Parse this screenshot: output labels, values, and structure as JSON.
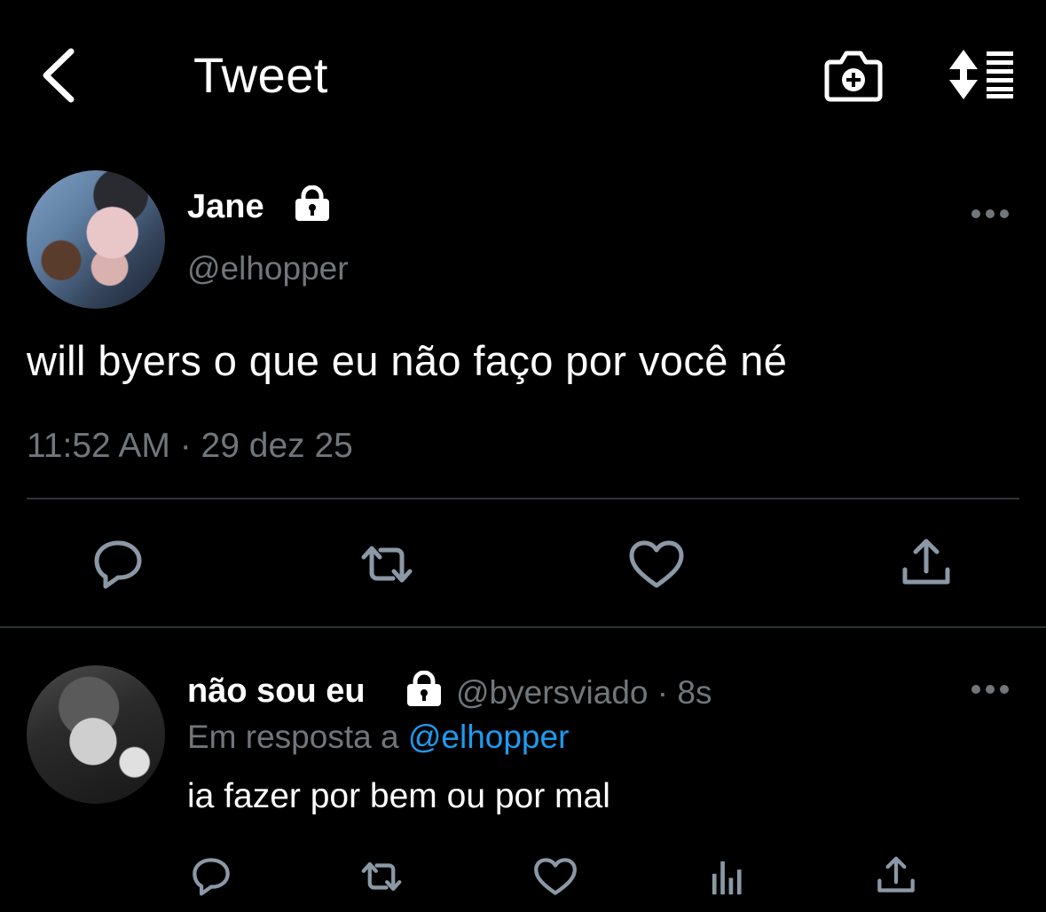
{
  "header": {
    "title": "Tweet",
    "back_icon": "chevron-left-icon",
    "camera_icon": "camera-plus-icon",
    "sort_icon": "sort-icon"
  },
  "tweet": {
    "author": {
      "name": "Jane",
      "handle": "@elhopper",
      "protected": true
    },
    "text": "will byers o que eu não faço por você né",
    "timestamp": "11:52 AM · 29 dez 25",
    "actions": [
      "reply-icon",
      "retweet-icon",
      "like-icon",
      "share-icon"
    ]
  },
  "reply": {
    "author": {
      "name": "não sou eu",
      "handle_time": "@byersviado · 8s",
      "protected": true
    },
    "reply_to_prefix": "Em resposta a ",
    "reply_to_mention": "@elhopper",
    "text": "ia fazer por bem ou por mal",
    "actions": [
      "reply-icon",
      "retweet-icon",
      "like-icon",
      "views-icon",
      "share-icon"
    ]
  },
  "colors": {
    "background": "#000000",
    "text": "#ffffff",
    "secondary": "#71767b",
    "link": "#1d9bf0",
    "divider": "#2f3336"
  }
}
